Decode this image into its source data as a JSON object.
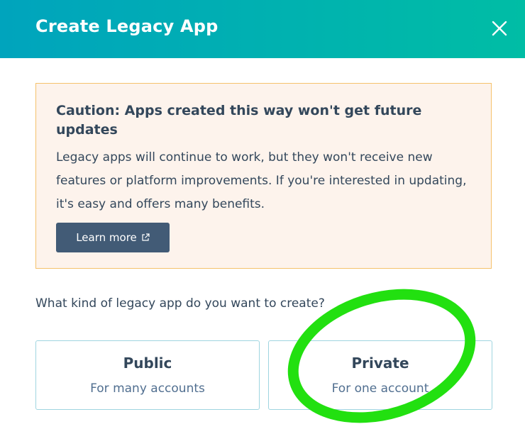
{
  "modal": {
    "title": "Create Legacy App",
    "close_icon": "close-icon"
  },
  "alert": {
    "title": "Caution: Apps created this way won't get future updates",
    "body": "Legacy apps will continue to work, but they won't receive new features or platform improvements. If you're interested in updating, it's easy and offers many benefits.",
    "button_label": "Learn more",
    "button_icon": "external-link-icon",
    "background_color": "#fdf3ec",
    "border_color": "#f5c26b"
  },
  "question": "What kind of legacy app do you want to create?",
  "options": [
    {
      "title": "Public",
      "subtitle": "For many accounts"
    },
    {
      "title": "Private",
      "subtitle": "For one account"
    }
  ],
  "colors": {
    "header_gradient_start": "#00a4bd",
    "header_gradient_end": "#00bda5",
    "button_bg": "#425b76",
    "highlight": "#22e010"
  }
}
